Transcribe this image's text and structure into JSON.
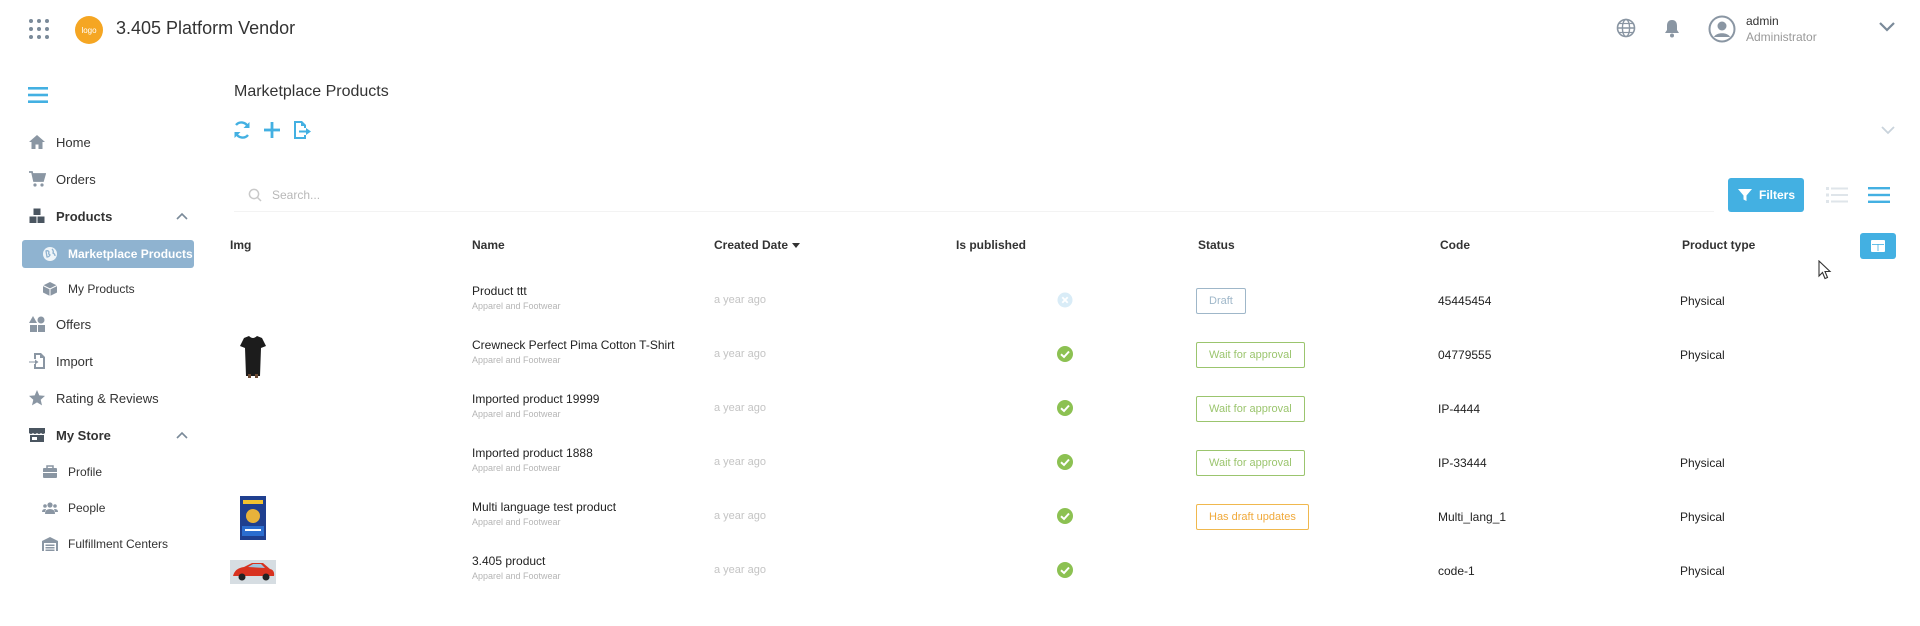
{
  "header": {
    "logo_text": "logo",
    "app_title": "3.405 Platform Vendor",
    "user": {
      "name": "admin",
      "role": "Administrator"
    }
  },
  "sidebar": {
    "items": [
      {
        "label": "Home",
        "icon": "home-icon"
      },
      {
        "label": "Orders",
        "icon": "cart-icon"
      },
      {
        "label": "Products",
        "icon": "cubes-icon",
        "expanded": true,
        "children": [
          {
            "label": "Marketplace Products",
            "icon": "globe-icon",
            "active": true
          },
          {
            "label": "My Products",
            "icon": "cube-icon"
          }
        ]
      },
      {
        "label": "Offers",
        "icon": "shapes-icon"
      },
      {
        "label": "Import",
        "icon": "file-import-icon"
      },
      {
        "label": "Rating & Reviews",
        "icon": "star-icon"
      },
      {
        "label": "My Store",
        "icon": "store-icon",
        "expanded": true,
        "children": [
          {
            "label": "Profile",
            "icon": "briefcase-icon"
          },
          {
            "label": "People",
            "icon": "users-icon"
          },
          {
            "label": "Fulfillment Centers",
            "icon": "warehouse-icon"
          }
        ]
      }
    ]
  },
  "main": {
    "title": "Marketplace Products",
    "search_placeholder": "Search...",
    "filters_label": "Filters",
    "columns": [
      "Img",
      "Name",
      "Created Date",
      "Is published",
      "Status",
      "Code",
      "Product type"
    ],
    "sorted_column": "Created Date",
    "rows": [
      {
        "image": "none",
        "name": "Product ttt",
        "category": "Apparel and Footwear",
        "created": "a year ago",
        "published": false,
        "status": "Draft",
        "status_kind": "draft",
        "code": "45445454",
        "type": "Physical"
      },
      {
        "image": "tshirt",
        "name": "Crewneck Perfect Pima Cotton T-Shirt",
        "category": "Apparel and Footwear",
        "created": "a year ago",
        "published": true,
        "status": "Wait for approval",
        "status_kind": "wait",
        "code": "04779555",
        "type": "Physical"
      },
      {
        "image": "none",
        "name": "Imported product 19999",
        "category": "Apparel and Footwear",
        "created": "a year ago",
        "published": true,
        "status": "Wait for approval",
        "status_kind": "wait",
        "code": "IP-4444",
        "type": ""
      },
      {
        "image": "none",
        "name": "Imported product 1888",
        "category": "Apparel and Footwear",
        "created": "a year ago",
        "published": true,
        "status": "Wait for approval",
        "status_kind": "wait",
        "code": "IP-33444",
        "type": "Physical"
      },
      {
        "image": "poster",
        "name": "Multi language test product",
        "category": "Apparel and Footwear",
        "created": "a year ago",
        "published": true,
        "status": "Has draft updates",
        "status_kind": "updates",
        "code": "Multi_lang_1",
        "type": "Physical"
      },
      {
        "image": "car",
        "name": "3.405 product",
        "category": "Apparel and Footwear",
        "created": "a year ago",
        "published": true,
        "status": "",
        "status_kind": "",
        "code": "code-1",
        "type": "Physical"
      }
    ]
  },
  "colors": {
    "accent": "#43b0e2",
    "active_nav": "#8fb3d0",
    "published": "#8cc152",
    "draft": "#9fb7c9",
    "wait": "#9bc56e",
    "updates": "#f0a93a"
  }
}
